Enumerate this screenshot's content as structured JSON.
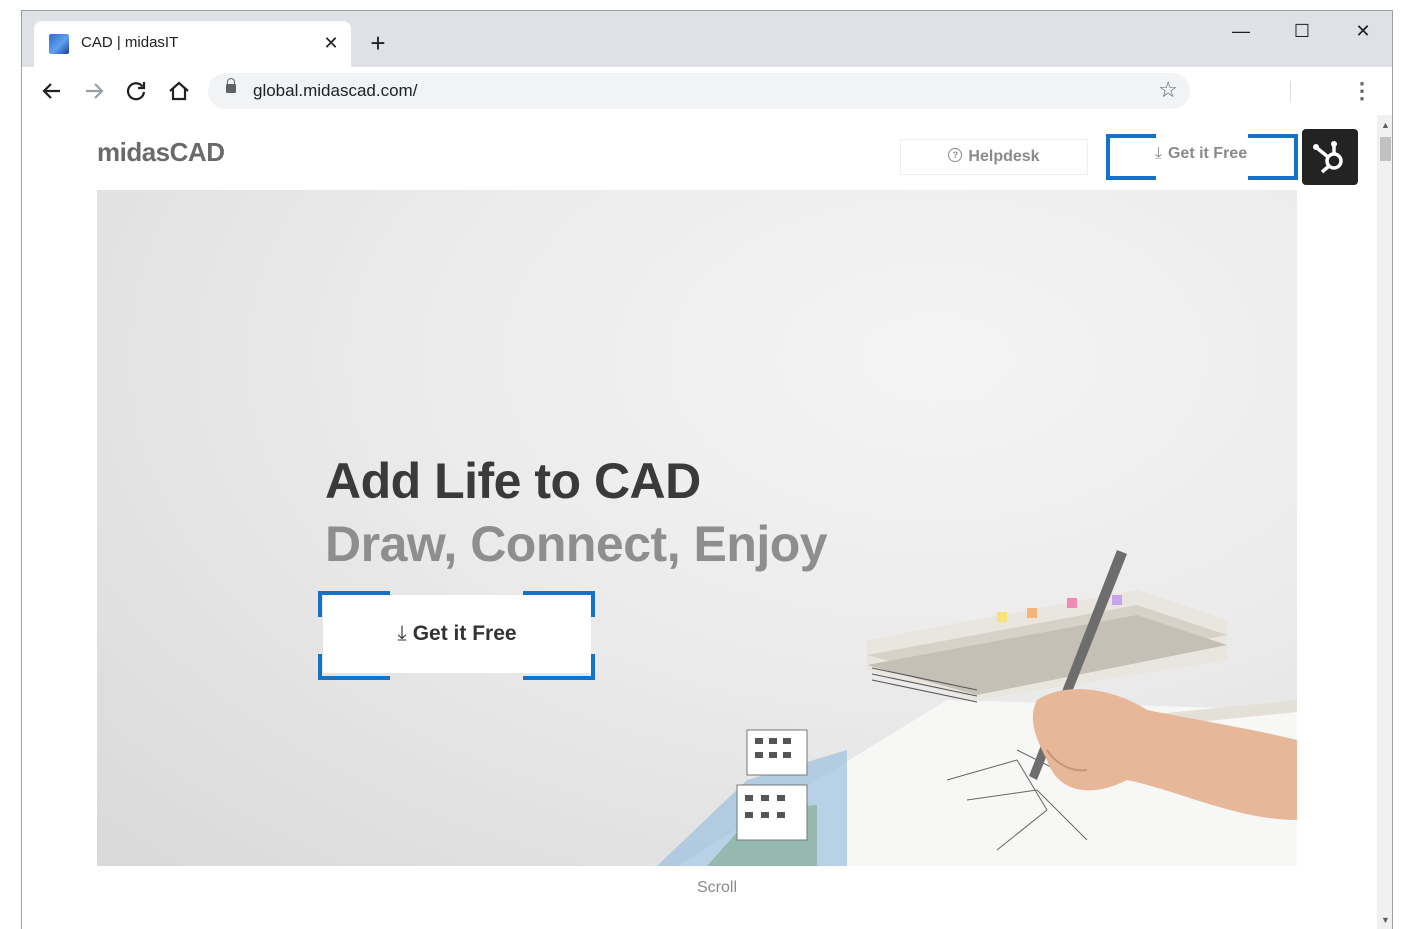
{
  "browser": {
    "tab": {
      "title": "CAD | midasIT",
      "favicon": "midasit-favicon-icon"
    },
    "new_tab_symbol": "+",
    "tab_close_symbol": "✕",
    "controls": {
      "minimize": "—",
      "maximize": "☐",
      "close": "✕"
    },
    "url": "global.midascad.com/",
    "icons": [
      "back-icon",
      "forward-icon",
      "reload-icon",
      "home-icon",
      "lock-icon",
      "star-icon",
      "menu-icon"
    ]
  },
  "page": {
    "logo": "midasCAD",
    "header": {
      "helpdesk_label": "Helpdesk",
      "get_free_label": "Get it Free"
    },
    "hero": {
      "title": "Add Life to CAD",
      "subtitle": "Draw, Connect, Enjoy",
      "cta_label": "Get it Free"
    },
    "scroll_label": "Scroll"
  },
  "colors": {
    "highlight_bracket": "#1473c7",
    "hubspot_button_bg": "#232323",
    "title_text": "#3a3a3a",
    "subtitle_text": "#8e8e8e"
  }
}
